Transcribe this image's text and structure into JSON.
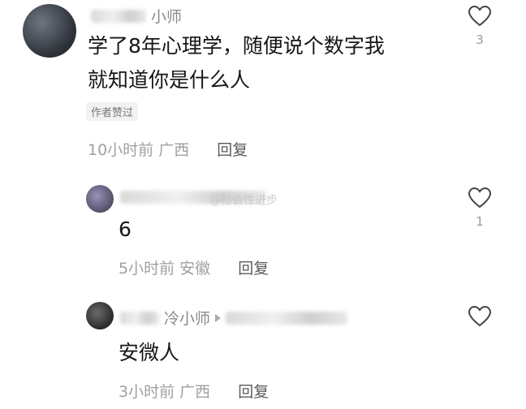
{
  "comments": [
    {
      "username": "小师",
      "text_line1": "学了8年心理学，随便说个数字我",
      "text_line2": "就知道你是什么人",
      "badge": "作者赞过",
      "time": "10小时前",
      "location": "广西",
      "reply_label": "回复",
      "likes": "3"
    },
    {
      "text": "6",
      "time": "5小时前",
      "location": "安徽",
      "reply_label": "回复",
      "likes": "1"
    },
    {
      "username": "冷小师",
      "text": "安微人",
      "time": "3小时前",
      "location": "广西",
      "reply_label": "回复"
    }
  ],
  "watermark": "@社会性进步"
}
